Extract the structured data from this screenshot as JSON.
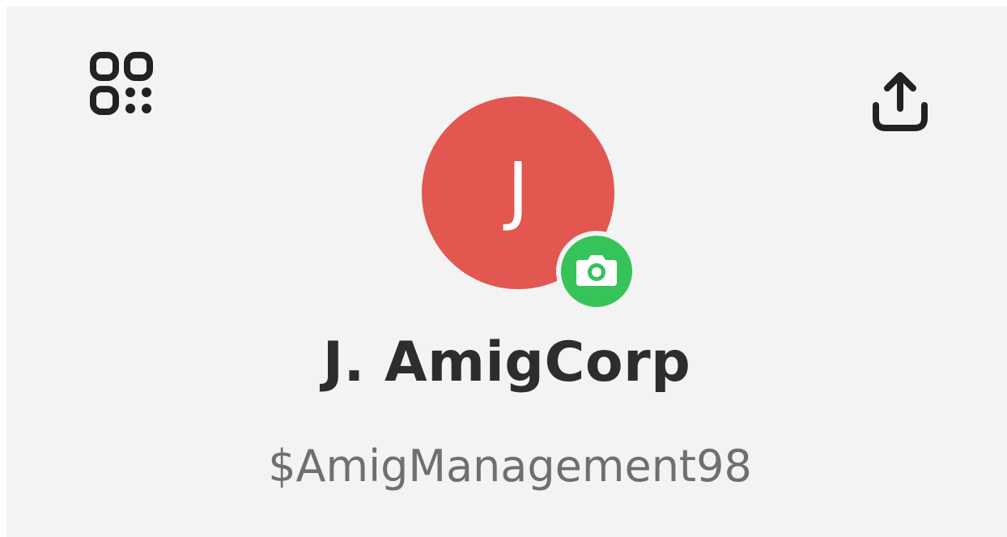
{
  "profile": {
    "avatar_initial": "J",
    "display_name": "J. AmigCorp",
    "cashtag": "$AmigManagement98"
  },
  "toolbar": {
    "left_icon": "qr-code-icon",
    "right_icon": "share-icon"
  },
  "avatar": {
    "badge_icon": "camera-icon"
  },
  "colors": {
    "background": "#f3f3f3",
    "avatar": "#e2574f",
    "badge": "#36c35a",
    "name_text": "#2d2d2d",
    "cashtag_text": "#6f6f6f",
    "icons": "#222222"
  }
}
